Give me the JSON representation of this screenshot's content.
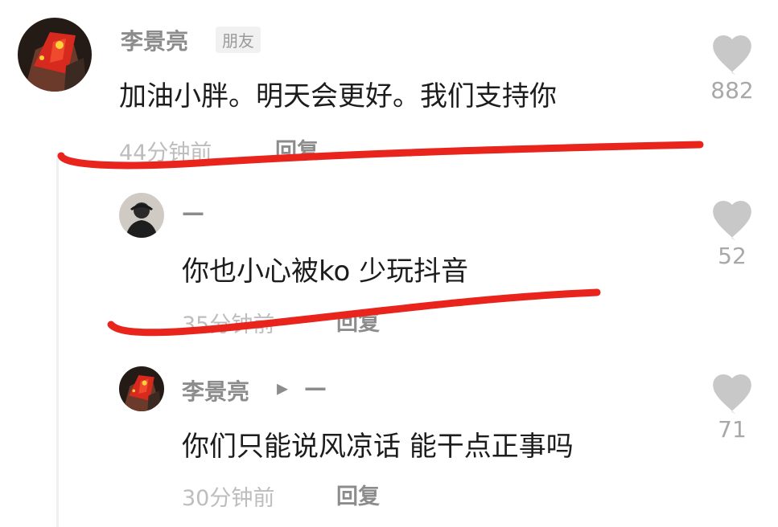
{
  "comments": [
    {
      "username": "李景亮",
      "badge": "朋友",
      "text": "加油小胖。明天会更好。我们支持你",
      "time": "44分钟前",
      "reply_label": "回复",
      "likes": "882",
      "avatar_icon": "flag-avatar-icon"
    },
    {
      "username": "—",
      "text": "你也小心被ko 少玩抖音",
      "time": "35分钟前",
      "reply_label": "回复",
      "likes": "52",
      "avatar_icon": "person-avatar-icon"
    },
    {
      "username": "李景亮",
      "reply_arrow": "▸",
      "reply_to": "—",
      "text": "你们只能说风凉话 能干点正事吗",
      "time": "30分钟前",
      "reply_label": "回复",
      "likes": "71",
      "avatar_icon": "flag-avatar-icon"
    }
  ],
  "colors": {
    "annotation_stroke": "#e8241c",
    "heart": "#c8c8c8",
    "username": "#8c8c8c",
    "comment_text": "#1c1c1c"
  }
}
